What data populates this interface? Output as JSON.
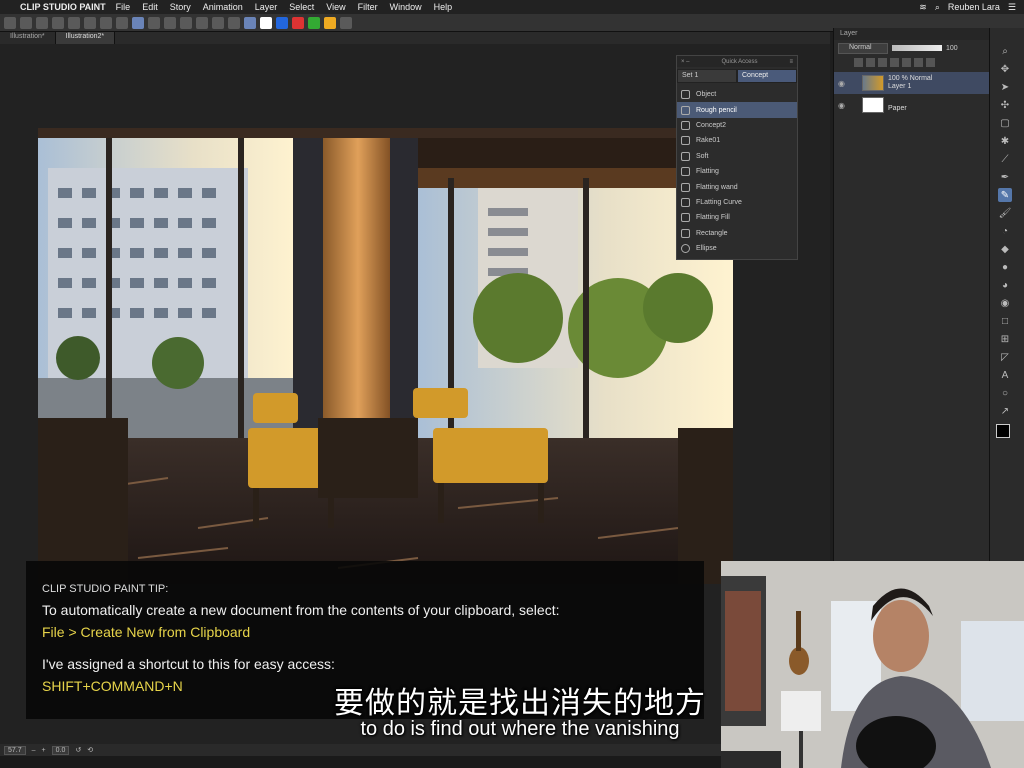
{
  "menubar": {
    "app": "CLIP STUDIO PAINT",
    "items": [
      "File",
      "Edit",
      "Story",
      "Animation",
      "Layer",
      "Select",
      "View",
      "Filter",
      "Window",
      "Help"
    ],
    "user": "Reuben Lara"
  },
  "tabs": [
    "Illustration*",
    "Illustration2*"
  ],
  "quick_access": {
    "title": "Quick Access",
    "sets": [
      "Set 1",
      "Concept"
    ],
    "items": [
      "Object",
      "Rough pencil",
      "Concept2",
      "Rake01",
      "Soft",
      "Flatting",
      "Flatting wand",
      "FLatting Curve",
      "Flatting Fill",
      "Rectangle",
      "Ellipse"
    ],
    "selected_index": 1
  },
  "layer_panel": {
    "title": "Layer",
    "blend_mode": "Normal",
    "opacity": "100",
    "layers": [
      {
        "line1": "100 % Normal",
        "line2": "Layer 1"
      },
      {
        "line1": "",
        "line2": "Paper"
      }
    ]
  },
  "status": {
    "zoom": "57.7",
    "angle": "0.0"
  },
  "tip": {
    "heading": "CLIP STUDIO PAINT TIP:",
    "line1": "To automatically create a new document from the contents of your clipboard, select:",
    "path": "File > Create New from Clipboard",
    "line2": "I've assigned a shortcut to this for easy access:",
    "shortcut": "SHIFT+COMMAND+N"
  },
  "subtitles": {
    "chinese": "要做的就是找出消失的地方",
    "english": "to do is find out where the vanishing"
  },
  "colors": {
    "accent": "#4b5a76",
    "tip_highlight": "#e7d44a"
  }
}
